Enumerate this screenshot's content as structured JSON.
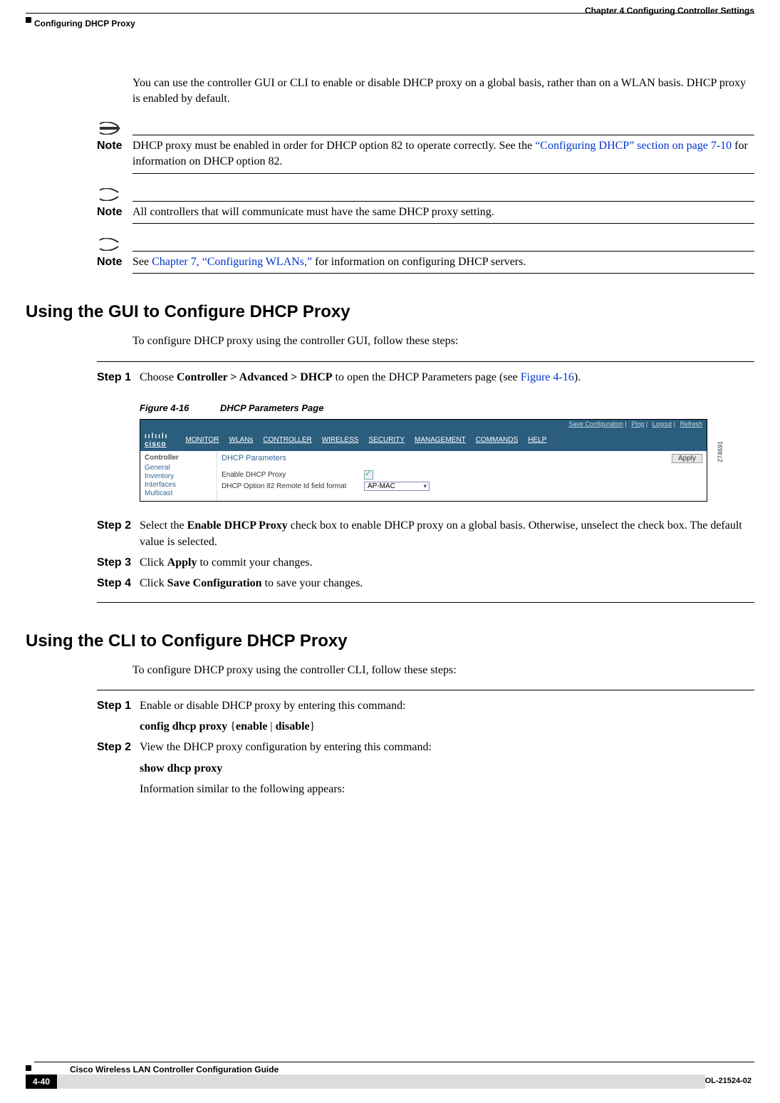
{
  "header": {
    "chapter": "Chapter 4      Configuring Controller Settings",
    "section": "Configuring DHCP Proxy"
  },
  "intro": "You can use the controller GUI or CLI to enable or disable DHCP proxy on a global basis, rather than on a WLAN basis. DHCP proxy is enabled by default.",
  "notes": {
    "note_label": "Note",
    "n1_pre": "DHCP proxy must be enabled in order for DHCP option 82 to operate correctly. See the ",
    "n1_link": "“Configuring DHCP” section on page 7-10",
    "n1_post": " for information on DHCP option 82.",
    "n2": "All controllers that will communicate must have the same DHCP proxy setting.",
    "n3_pre": "See ",
    "n3_link": "Chapter 7, “Configuring WLANs,”",
    "n3_post": " for information on configuring DHCP servers."
  },
  "gui": {
    "heading": "Using the GUI to Configure DHCP Proxy",
    "intro": "To configure DHCP proxy using the controller GUI, follow these steps:",
    "step1_label": "Step 1",
    "step1_pre": "Choose ",
    "step1_bold": "Controller > Advanced > DHCP",
    "step1_mid": " to open the DHCP Parameters page (see ",
    "step1_link": "Figure 4-16",
    "step1_post": ").",
    "fig_num": "Figure 4-16",
    "fig_title": "DHCP Parameters Page",
    "step2_label": "Step 2",
    "step2_pre": "Select the ",
    "step2_bold": "Enable DHCP Proxy",
    "step2_post": " check box to enable DHCP proxy on a global basis. Otherwise, unselect the check box. The default value is selected.",
    "step3_label": "Step 3",
    "step3_pre": "Click ",
    "step3_bold": "Apply",
    "step3_post": " to commit your changes.",
    "step4_label": "Step 4",
    "step4_pre": "Click ",
    "step4_bold": "Save Configuration",
    "step4_post": " to save your changes."
  },
  "screenshot": {
    "toplinks": {
      "save": "Save Configuration",
      "ping": "Ping",
      "logout": "Logout",
      "refresh": "Refresh"
    },
    "logo": "cisco",
    "nav": {
      "monitor": "MONITOR",
      "wlans": "WLANs",
      "controller": "CONTROLLER",
      "wireless": "WIRELESS",
      "security": "SECURITY",
      "management": "MANAGEMENT",
      "commands": "COMMANDS",
      "help": "HELP"
    },
    "side_title": "Controller",
    "side": {
      "general": "General",
      "inventory": "Inventory",
      "interfaces": "Interfaces",
      "multicast": "Multicast"
    },
    "main_title": "DHCP Parameters",
    "apply": "Apply",
    "f1_label": "Enable DHCP Proxy",
    "f2_label": "DHCP Option 82 Remote Id field format",
    "f2_value": "AP-MAC",
    "sidecode": "274691"
  },
  "cli": {
    "heading": "Using the CLI to Configure DHCP Proxy",
    "intro": "To configure DHCP proxy using the controller CLI, follow these steps:",
    "step1_label": "Step 1",
    "step1_text": "Enable or disable DHCP proxy by entering this command:",
    "step1_cmd_a": "config dhcp proxy",
    "step1_cmd_b": " {",
    "step1_cmd_c": "enable",
    "step1_cmd_d": " | ",
    "step1_cmd_e": "disable",
    "step1_cmd_f": "}",
    "step2_label": "Step 2",
    "step2_text": "View the DHCP proxy configuration by entering this command:",
    "step2_cmd": "show dhcp proxy",
    "step2_after": "Information similar to the following appears:"
  },
  "footer": {
    "book": "Cisco Wireless LAN Controller Configuration Guide",
    "page": "4-40",
    "code": "OL-21524-02"
  }
}
